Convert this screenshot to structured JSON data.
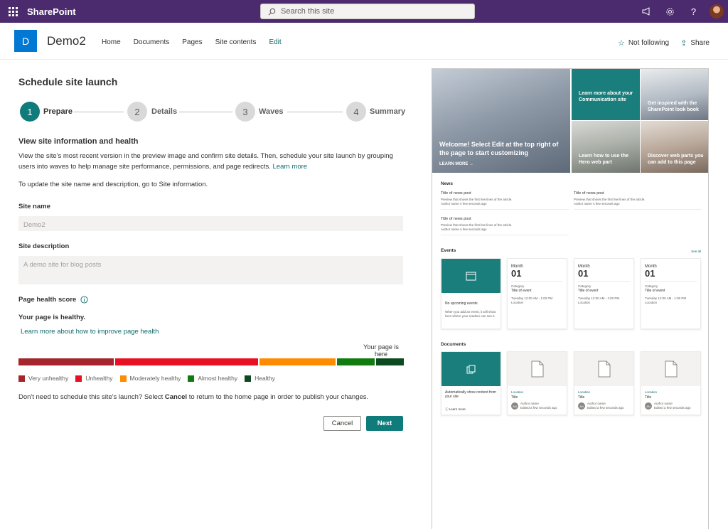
{
  "suite": {
    "brand": "SharePoint",
    "search_placeholder": "Search this site"
  },
  "site": {
    "logo_letter": "D",
    "title": "Demo2",
    "nav": [
      "Home",
      "Documents",
      "Pages",
      "Site contents",
      "Edit"
    ],
    "follow_label": "Not following",
    "share_label": "Share"
  },
  "panel": {
    "title": "Schedule site launch",
    "steps": [
      {
        "num": "1",
        "label": "Prepare"
      },
      {
        "num": "2",
        "label": "Details"
      },
      {
        "num": "3",
        "label": "Waves"
      },
      {
        "num": "4",
        "label": "Summary"
      }
    ],
    "section_title": "View site information and health",
    "intro": "View the site's most recent version in the preview image and confirm site details. Then, schedule your site launch by grouping users into waves to help manage site performance, permissions, and page redirects.",
    "intro_link": "Learn more",
    "rename_text": "To update the site name and description, go to Site information.",
    "site_name_label": "Site name",
    "site_name_value": "Demo2",
    "site_desc_label": "Site description",
    "site_desc_value": "A demo site for blog posts",
    "health_label": "Page health score",
    "health_status": "Your page is healthy.",
    "health_link": "Learn more about how to improve page health",
    "marker_text": "Your page is here",
    "legend": [
      "Very unhealthy",
      "Unhealthy",
      "Moderately healthy",
      "Almost healthy",
      "Healthy"
    ],
    "footer_pre": "Don't need to schedule this site's launch? Select ",
    "footer_bold": "Cancel",
    "footer_post": " to return to the home page in order to publish your changes.",
    "cancel_label": "Cancel",
    "next_label": "Next"
  },
  "colors": {
    "suite": "#4b2a6e",
    "teal": "#0f7b7b",
    "very_unhealthy": "#a4262c",
    "unhealthy": "#e81123",
    "moderately_healthy": "#ff8c00",
    "almost_healthy": "#107c10",
    "healthy": "#0b4a1e"
  },
  "preview": {
    "hero_main": "Welcome! Select Edit at the top right of the page to start customizing",
    "hero_more": "LEARN MORE →",
    "hero_t2": "Learn more about your Communication site",
    "hero_t3": "Get inspired with the SharePoint look book",
    "hero_t4": "Learn how to use the Hero web part",
    "hero_t5": "Discover web parts you can add to this page",
    "news_title": "News",
    "news_item_title": "Title of news post",
    "news_item_preview": "Preview that shows the first few lines of the article.",
    "news_item_author": "Author name  A few seconds ago",
    "events_title": "Events",
    "see_all": "See all",
    "no_events": "No upcoming events",
    "no_events_sub": "When you add an event, it will show here where your readers can see it.",
    "event_month": "Month",
    "event_day": "01",
    "event_category": "Category",
    "event_title": "Title of event",
    "event_time": "Tuesday 12:00 AM - 1:00 PM",
    "event_location": "Location",
    "docs_title": "Documents",
    "docs_auto": "Automatically show content from your site",
    "docs_learn": "Learn more",
    "doc_location": "Location",
    "doc_title": "Title",
    "doc_initials": "AN",
    "doc_author": "Author name",
    "doc_time": "Edited a few seconds ago"
  }
}
